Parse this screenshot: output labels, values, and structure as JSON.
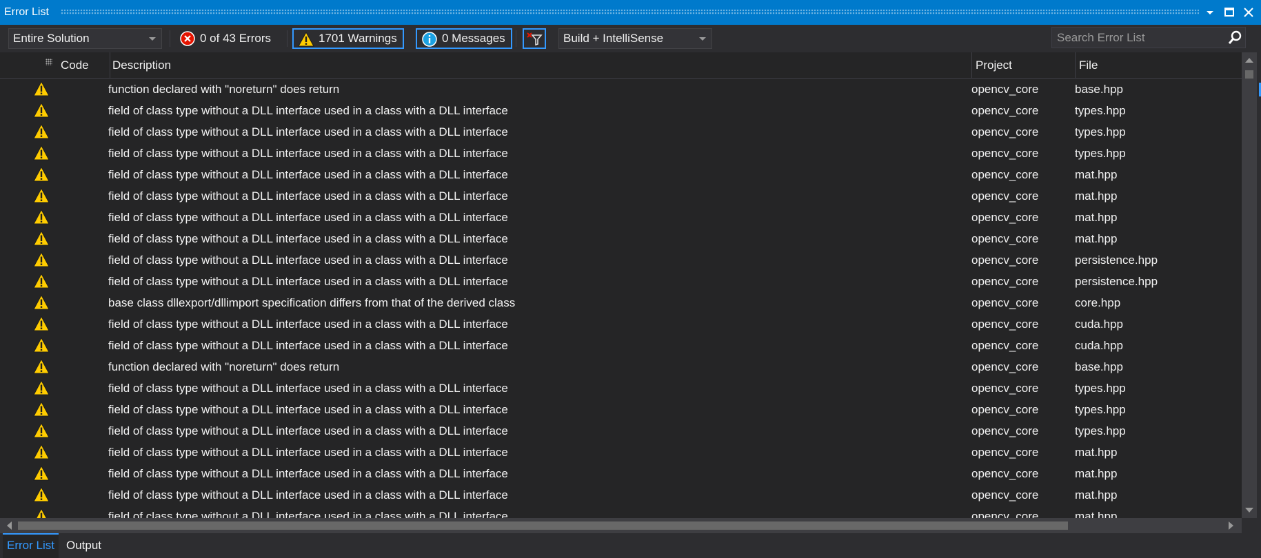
{
  "window": {
    "title": "Error List"
  },
  "toolbar": {
    "scope": "Entire Solution",
    "errors_label": "0 of 43 Errors",
    "warnings_label": "1701 Warnings",
    "messages_label": "0 Messages",
    "build_filter": "Build + IntelliSense",
    "search_placeholder": "Search Error List"
  },
  "columns": {
    "code": "Code",
    "description": "Description",
    "project": "Project",
    "file": "File"
  },
  "rows": [
    {
      "description": "function declared with \"noreturn\" does return",
      "project": "opencv_core",
      "file": "base.hpp"
    },
    {
      "description": "field of class type without a DLL interface used in a class with a DLL interface",
      "project": "opencv_core",
      "file": "types.hpp"
    },
    {
      "description": "field of class type without a DLL interface used in a class with a DLL interface",
      "project": "opencv_core",
      "file": "types.hpp"
    },
    {
      "description": "field of class type without a DLL interface used in a class with a DLL interface",
      "project": "opencv_core",
      "file": "types.hpp"
    },
    {
      "description": "field of class type without a DLL interface used in a class with a DLL interface",
      "project": "opencv_core",
      "file": "mat.hpp"
    },
    {
      "description": "field of class type without a DLL interface used in a class with a DLL interface",
      "project": "opencv_core",
      "file": "mat.hpp"
    },
    {
      "description": "field of class type without a DLL interface used in a class with a DLL interface",
      "project": "opencv_core",
      "file": "mat.hpp"
    },
    {
      "description": "field of class type without a DLL interface used in a class with a DLL interface",
      "project": "opencv_core",
      "file": "mat.hpp"
    },
    {
      "description": "field of class type without a DLL interface used in a class with a DLL interface",
      "project": "opencv_core",
      "file": "persistence.hpp"
    },
    {
      "description": "field of class type without a DLL interface used in a class with a DLL interface",
      "project": "opencv_core",
      "file": "persistence.hpp"
    },
    {
      "description": "base class dllexport/dllimport specification differs from that of the derived class",
      "project": "opencv_core",
      "file": "core.hpp"
    },
    {
      "description": "field of class type without a DLL interface used in a class with a DLL interface",
      "project": "opencv_core",
      "file": "cuda.hpp"
    },
    {
      "description": "field of class type without a DLL interface used in a class with a DLL interface",
      "project": "opencv_core",
      "file": "cuda.hpp"
    },
    {
      "description": "function declared with \"noreturn\" does return",
      "project": "opencv_core",
      "file": "base.hpp"
    },
    {
      "description": "field of class type without a DLL interface used in a class with a DLL interface",
      "project": "opencv_core",
      "file": "types.hpp"
    },
    {
      "description": "field of class type without a DLL interface used in a class with a DLL interface",
      "project": "opencv_core",
      "file": "types.hpp"
    },
    {
      "description": "field of class type without a DLL interface used in a class with a DLL interface",
      "project": "opencv_core",
      "file": "types.hpp"
    },
    {
      "description": "field of class type without a DLL interface used in a class with a DLL interface",
      "project": "opencv_core",
      "file": "mat.hpp"
    },
    {
      "description": "field of class type without a DLL interface used in a class with a DLL interface",
      "project": "opencv_core",
      "file": "mat.hpp"
    },
    {
      "description": "field of class type without a DLL interface used in a class with a DLL interface",
      "project": "opencv_core",
      "file": "mat.hpp"
    },
    {
      "description": "field of class type without a DLL interface used in a class with a DLL interface",
      "project": "opencv_core",
      "file": "mat.hpp"
    }
  ],
  "tabs": [
    {
      "label": "Error List",
      "active": true
    },
    {
      "label": "Output",
      "active": false
    }
  ],
  "colors": {
    "accent": "#007acc",
    "warning": "#ffcc00",
    "error": "#e51400",
    "info": "#1ba1e2",
    "active_border": "#3399ff"
  }
}
